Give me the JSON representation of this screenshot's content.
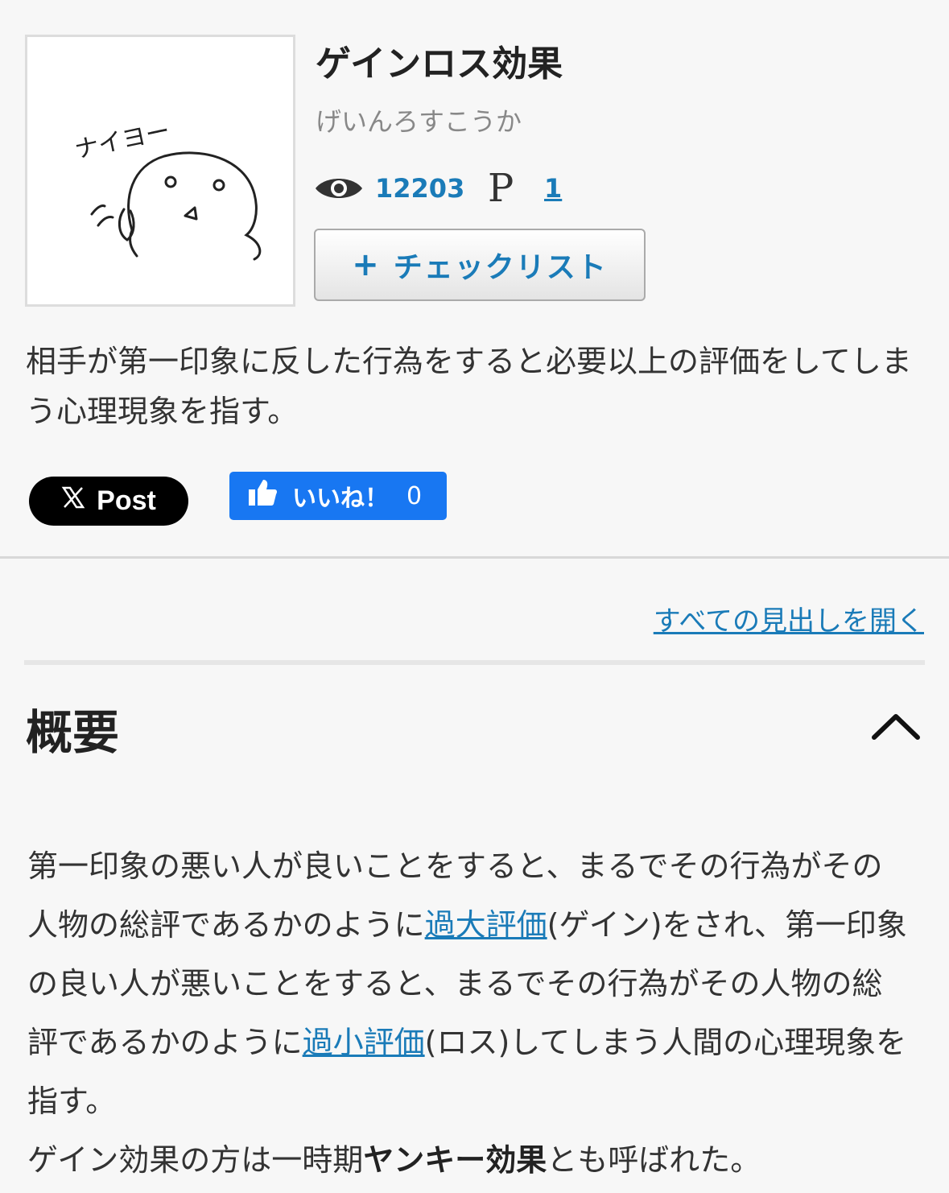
{
  "article": {
    "title": "ゲインロス効果",
    "reading": "げいんろすこうか",
    "thumbnail_caption": "ナイヨー",
    "views": "12203",
    "pico_count": "1",
    "pico_icon": "P",
    "checklist_plus": "+",
    "checklist_label": "チェックリスト",
    "summary": "相手が第一印象に反した行為をすると必要以上の評価をしてしまう心理現象を指す。"
  },
  "share": {
    "x_label": "Post",
    "fb_label": "いいね！",
    "fb_count": "0"
  },
  "toc": {
    "open_all": "すべての見出しを開く"
  },
  "section": {
    "title": "概要",
    "p1_a": "第一印象の悪い人が良いことをすると、まるでその行為がその人物の総評であるかのように",
    "p1_link1": "過大評価",
    "p1_b": "(ゲイン)をされ、第一印象の良い人が悪いことをすると、まるでその行為がその人物の総評であるかのように",
    "p1_link2": "過小評価",
    "p1_c": "(ロス)してしまう人間の心理現象を指す。",
    "p2_a": "ゲイン効果の方は一時期",
    "p2_bold": "ヤンキー効果",
    "p2_b": "とも呼ばれた。"
  },
  "icons": {
    "views": "eye-icon",
    "pico": "pico-p-icon",
    "x": "x-logo-icon",
    "like": "thumbs-up-icon",
    "collapse": "chevron-up-icon"
  },
  "colors": {
    "link": "#1a7bb8",
    "facebook": "#1877f2",
    "x": "#000000"
  }
}
